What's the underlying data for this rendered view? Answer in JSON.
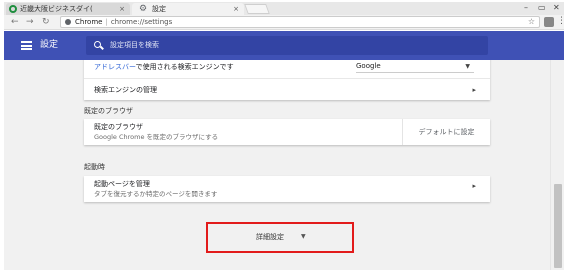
{
  "browser": {
    "tabs": [
      {
        "title": "近畿大阪ビジネスダイ(",
        "close": "×"
      },
      {
        "title": "設定",
        "close": "×"
      }
    ],
    "url_site": "Chrome",
    "url_path": "chrome://settings",
    "icons": [
      "back-arrow-icon",
      "forward-arrow-icon",
      "reload-icon",
      "star-icon",
      "menu-dots-icon"
    ]
  },
  "header": {
    "title": "設定",
    "search_placeholder": "設定項目を検索",
    "color": "#3f51b5"
  },
  "search_engine": {
    "row1_label_link": "アドレスバー",
    "row1_label_rest": "で使用される検索エンジンです",
    "row1_value": "Google",
    "row2_label": "検索エンジンの管理"
  },
  "default_browser": {
    "section_title": "既定のブラウザ",
    "title": "既定のブラウザ",
    "subtitle": "Google Chrome を既定のブラウザにする",
    "button": "デフォルトに設定"
  },
  "startup": {
    "section_title": "起動時",
    "title": "起動ページを管理",
    "subtitle": "タブを復元するか特定のページを開きます"
  },
  "advanced": {
    "label": "詳細設定",
    "highlight_color": "#e21b1b"
  }
}
